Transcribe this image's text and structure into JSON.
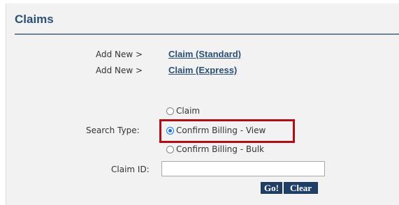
{
  "panel": {
    "title": "Claims"
  },
  "add_new": [
    {
      "label": "Add New >",
      "link": "Claim (Standard)"
    },
    {
      "label": "Add New >",
      "link": "Claim (Express)"
    }
  ],
  "search": {
    "label": "Search Type:",
    "options": [
      {
        "label": "Claim",
        "selected": false
      },
      {
        "label": "Confirm Billing - View",
        "selected": true
      },
      {
        "label": "Confirm Billing - Bulk",
        "selected": false
      }
    ],
    "highlight_color": "#b20d14"
  },
  "claim_id": {
    "label": "Claim ID:",
    "value": ""
  },
  "buttons": {
    "go": "Go!",
    "clear": "Clear"
  },
  "colors": {
    "title": "#2c4f73",
    "link": "#2b4f74",
    "button_bg": "#1f3f66",
    "radio_selected": "#1a73e8"
  }
}
